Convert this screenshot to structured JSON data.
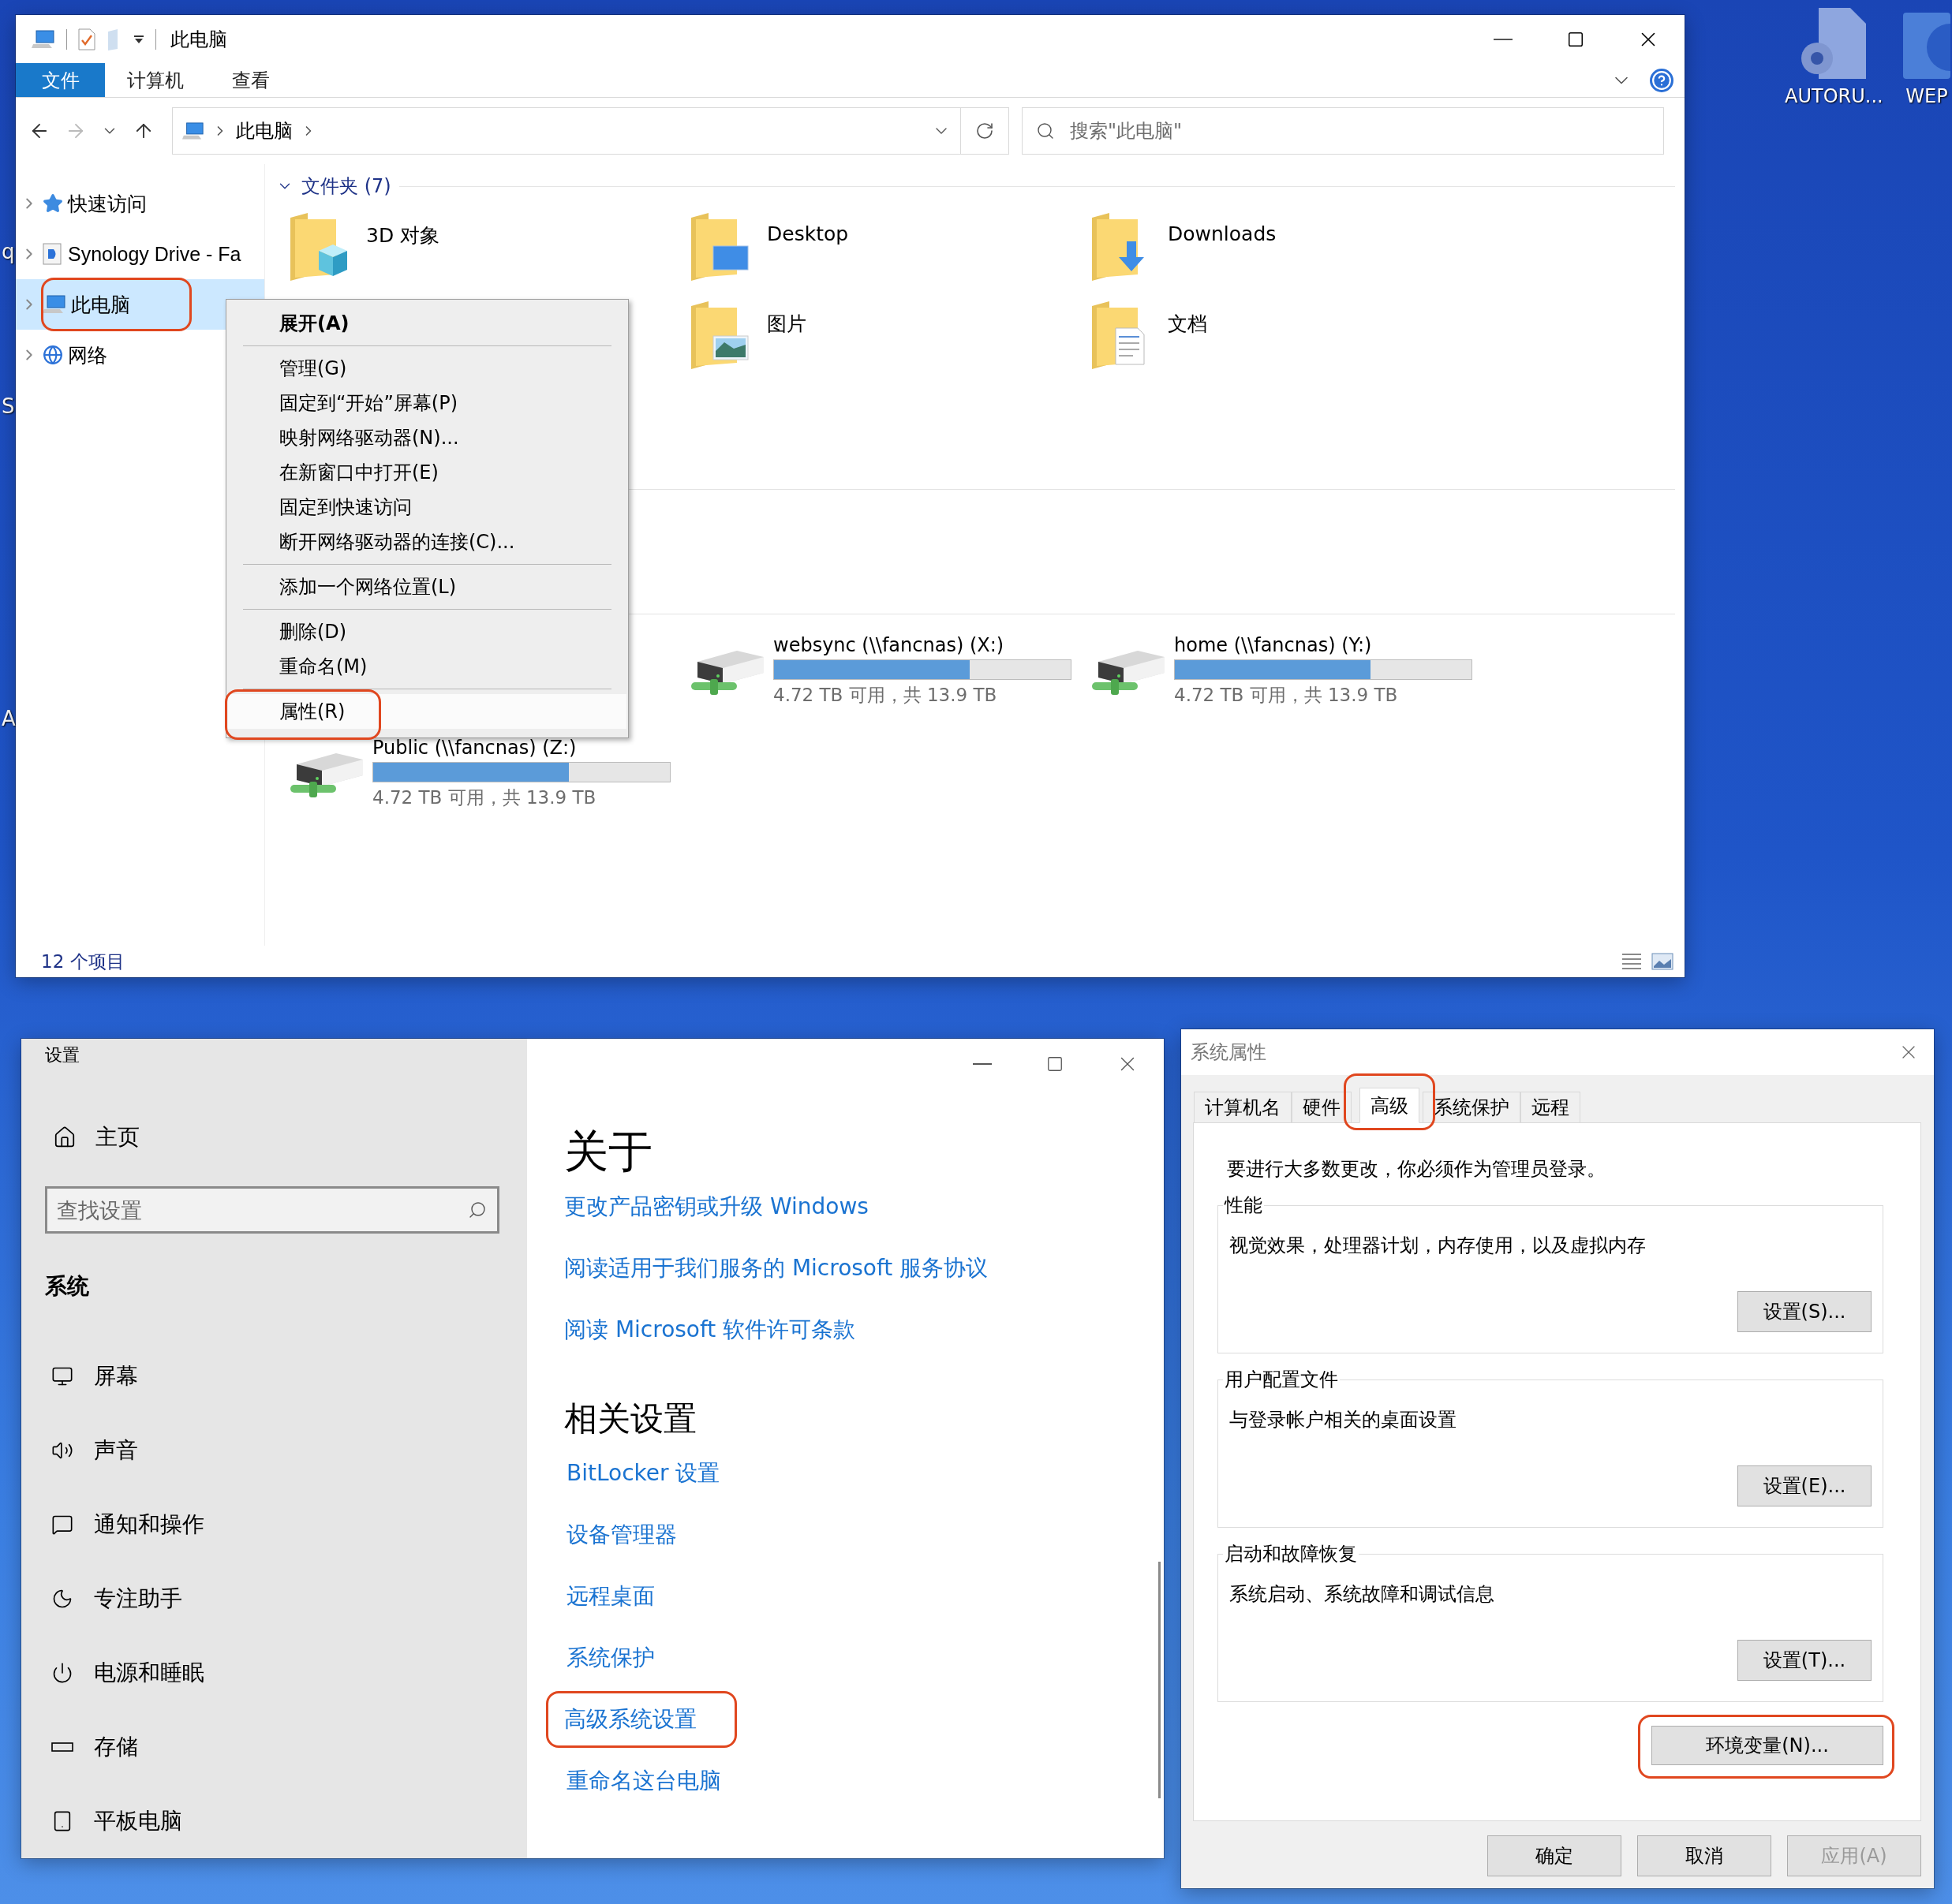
{
  "desktop": {
    "icons": [
      {
        "label": "AUTORU...",
        "kind": "settings-file"
      },
      {
        "label": "WEP",
        "kind": "disc"
      }
    ],
    "edge_labels": [
      "q",
      "S",
      "A"
    ]
  },
  "explorer": {
    "title": "此电脑",
    "ribbon_tabs": [
      {
        "label": "文件",
        "selected": true
      },
      {
        "label": "计算机",
        "selected": false
      },
      {
        "label": "查看",
        "selected": false
      }
    ],
    "address": "此电脑",
    "search_placeholder": "搜索\"此电脑\"",
    "nav": [
      {
        "label": "快速访问",
        "selected": false,
        "circled": false
      },
      {
        "label": "Synology Drive - Fa",
        "selected": false,
        "circled": false
      },
      {
        "label": "此电脑",
        "selected": true,
        "circled": true
      },
      {
        "label": "网络",
        "selected": false,
        "circled": false
      }
    ],
    "folders_header": "文件夹 (7)",
    "folders": [
      {
        "name": "3D 对象",
        "kind": "cube"
      },
      {
        "name": "Desktop",
        "kind": "desktop"
      },
      {
        "name": "Downloads",
        "kind": "download"
      },
      {
        "name": "图片",
        "kind": "pictures"
      },
      {
        "name": "文档",
        "kind": "documents"
      }
    ],
    "drives": [
      {
        "name": "websync (\\\\fancnas) (X:)",
        "level": 0.66,
        "capacity": "4.72 TB 可用，共 13.9 TB"
      },
      {
        "name": "home (\\\\fancnas) (Y:)",
        "level": 0.66,
        "capacity": "4.72 TB 可用，共 13.9 TB"
      },
      {
        "name": "Public (\\\\fancnas) (Z:)",
        "level": 0.66,
        "capacity": "4.72 TB 可用，共 13.9 TB"
      }
    ],
    "status": "12 个项目"
  },
  "context_menu": {
    "items": [
      {
        "kind": "item",
        "label": "展开(A)",
        "default": true,
        "highlighted": false,
        "circled": false
      },
      {
        "kind": "separator"
      },
      {
        "kind": "item",
        "label": "管理(G)",
        "default": false,
        "highlighted": false,
        "circled": false
      },
      {
        "kind": "item",
        "label": "固定到“开始”屏幕(P)",
        "default": false,
        "highlighted": false,
        "circled": false
      },
      {
        "kind": "item",
        "label": "映射网络驱动器(N)...",
        "default": false,
        "highlighted": false,
        "circled": false
      },
      {
        "kind": "item",
        "label": "在新窗口中打开(E)",
        "default": false,
        "highlighted": false,
        "circled": false
      },
      {
        "kind": "item",
        "label": "固定到快速访问",
        "default": false,
        "highlighted": false,
        "circled": false
      },
      {
        "kind": "item",
        "label": "断开网络驱动器的连接(C)...",
        "default": false,
        "highlighted": false,
        "circled": false
      },
      {
        "kind": "separator"
      },
      {
        "kind": "item",
        "label": "添加一个网络位置(L)",
        "default": false,
        "highlighted": false,
        "circled": false
      },
      {
        "kind": "separator"
      },
      {
        "kind": "item",
        "label": "删除(D)",
        "default": false,
        "highlighted": false,
        "circled": false
      },
      {
        "kind": "item",
        "label": "重命名(M)",
        "default": false,
        "highlighted": false,
        "circled": false
      },
      {
        "kind": "separator"
      },
      {
        "kind": "item",
        "label": "属性(R)",
        "default": false,
        "highlighted": true,
        "circled": true
      }
    ]
  },
  "settings": {
    "title": "设置",
    "home": "主页",
    "search_placeholder": "查找设置",
    "section": "系统",
    "nav": [
      "屏幕",
      "声音",
      "通知和操作",
      "专注助手",
      "电源和睡眠",
      "存储",
      "平板电脑"
    ],
    "heading": "关于",
    "links": [
      "更改产品密钥或升级 Windows",
      "阅读适用于我们服务的 Microsoft 服务协议",
      "阅读 Microsoft 软件许可条款"
    ],
    "related_heading": "相关设置",
    "related_links": [
      {
        "label": "BitLocker 设置",
        "circled": false
      },
      {
        "label": "设备管理器",
        "circled": false
      },
      {
        "label": "远程桌面",
        "circled": false
      },
      {
        "label": "系统保护",
        "circled": false
      },
      {
        "label": "高级系统设置",
        "circled": true
      },
      {
        "label": "重命名这台电脑",
        "circled": false
      }
    ]
  },
  "system_properties": {
    "title": "系统属性",
    "tabs": [
      {
        "label": "计算机名",
        "selected": false,
        "circled": false
      },
      {
        "label": "硬件",
        "selected": false,
        "circled": false
      },
      {
        "label": "高级",
        "selected": true,
        "circled": true
      },
      {
        "label": "系统保护",
        "selected": false,
        "circled": false
      },
      {
        "label": "远程",
        "selected": false,
        "circled": false
      }
    ],
    "notice": "要进行大多数更改，你必须作为管理员登录。",
    "groups": [
      {
        "title": "性能",
        "description": "视觉效果，处理器计划，内存使用，以及虚拟内存",
        "button": "设置(S)..."
      },
      {
        "title": "用户配置文件",
        "description": "与登录帐户相关的桌面设置",
        "button": "设置(E)..."
      },
      {
        "title": "启动和故障恢复",
        "description": "系统启动、系统故障和调试信息",
        "button": "设置(T)..."
      }
    ],
    "env_button": {
      "label": "环境变量(N)...",
      "circled": true
    },
    "buttons": [
      {
        "label": "确定",
        "disabled": false
      },
      {
        "label": "取消",
        "disabled": false
      },
      {
        "label": "应用(A)",
        "disabled": true
      }
    ]
  }
}
